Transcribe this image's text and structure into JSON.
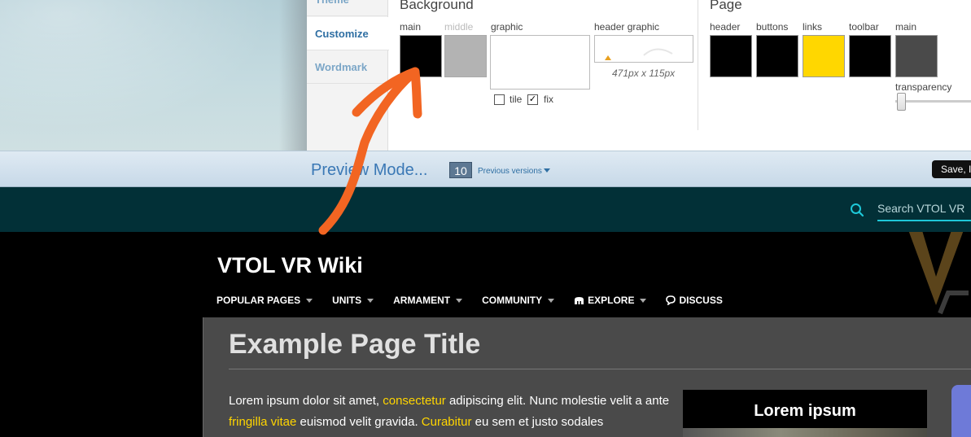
{
  "designer": {
    "tabs": [
      {
        "label": "Theme"
      },
      {
        "label": "Customize"
      },
      {
        "label": "Wordmark"
      }
    ],
    "background": {
      "title": "Background",
      "main_label": "main",
      "main_color": "#000000",
      "middle_label": "middle",
      "middle_color": "#b3b3b3",
      "graphic_label": "graphic",
      "tile_label": "tile",
      "tile_checked": false,
      "fix_label": "fix",
      "fix_checked": true,
      "header_graphic_label": "header graphic",
      "header_graphic_size": "471px x 115px"
    },
    "page": {
      "title": "Page",
      "swatches": [
        {
          "label": "header",
          "color": "#000000"
        },
        {
          "label": "buttons",
          "color": "#000000"
        },
        {
          "label": "links",
          "color": "#ffd700"
        },
        {
          "label": "toolbar",
          "color": "#000000"
        },
        {
          "label": "main",
          "color": "#4a4a4a"
        }
      ],
      "transparency_label": "transparency"
    }
  },
  "preview_bar": {
    "mode_label": "Preview Mode...",
    "version_count": "10",
    "previous_versions_label": "Previous versions",
    "save_label": "Save, I"
  },
  "global_nav": {
    "search_placeholder": "Search VTOL VR"
  },
  "wiki": {
    "name": "VTOL VR Wiki",
    "nav": [
      {
        "label": "POPULAR PAGES",
        "dropdown": true,
        "icon": ""
      },
      {
        "label": "UNITS",
        "dropdown": true,
        "icon": ""
      },
      {
        "label": "ARMAMENT",
        "dropdown": true,
        "icon": ""
      },
      {
        "label": "COMMUNITY",
        "dropdown": true,
        "icon": ""
      },
      {
        "label": "EXPLORE",
        "dropdown": true,
        "icon": "explore-icon"
      },
      {
        "label": "DISCUSS",
        "dropdown": false,
        "icon": "discuss-icon"
      }
    ]
  },
  "content": {
    "page_title": "Example Page Title",
    "paragraph": {
      "t1": "Lorem ipsum dolor sit amet, ",
      "l1": "consectetur",
      "t2": " adipiscing elit. Nunc molestie velit a ante ",
      "l2": "fringilla vitae",
      "t3": " euismod velit gravida. ",
      "l3": "Curabitur",
      "t4": " eu sem et justo sodales"
    },
    "infobox_title": "Lorem ipsum"
  },
  "colors": {
    "accent_link": "#ffd500",
    "global_nav_bg": "#023037",
    "search_accent": "#1ec8d8",
    "annotation_arrow": "#f26522"
  }
}
